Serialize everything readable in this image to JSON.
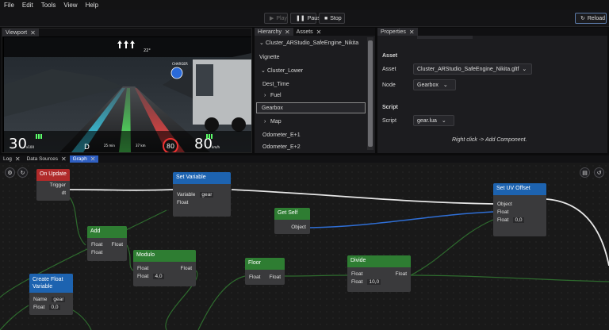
{
  "menu": [
    "File",
    "Edit",
    "Tools",
    "View",
    "Help"
  ],
  "toolbar": {
    "play": "Play",
    "pause": "Pause",
    "stop": "Stop",
    "reload": "Reload"
  },
  "viewport": {
    "tab": "Viewport",
    "hud": {
      "speed_left": "30",
      "speed_left_unit": "x100",
      "gear": "D",
      "distance_1": "25 min",
      "distance_2": "37 km",
      "speed_limit": "80",
      "speed_right": "80",
      "speed_right_unit": "km/h",
      "temp": "22°",
      "charger": "CHARGER"
    }
  },
  "hierarchy": {
    "tabs": [
      "Hierarchy",
      "Assets"
    ],
    "items": [
      {
        "label": "Cluster_ARStudio_SafeEngine_Nikita",
        "arrow": "⌄",
        "indent": 0
      },
      {
        "label": "Vignette",
        "arrow": "",
        "indent": 0
      },
      {
        "label": "Cluster_Lower",
        "arrow": "⌄",
        "indent": 1
      },
      {
        "label": "Dest_Time",
        "arrow": "",
        "indent": 1
      },
      {
        "label": "Fuel",
        "arrow": "›",
        "indent": 2
      },
      {
        "label": "Gearbox",
        "arrow": "",
        "indent": 1,
        "selected": true
      },
      {
        "label": "Map",
        "arrow": "›",
        "indent": 2
      },
      {
        "label": "Odometer_E+1",
        "arrow": "",
        "indent": 1
      },
      {
        "label": "Odometer_E+2",
        "arrow": "",
        "indent": 1
      }
    ]
  },
  "properties": {
    "tab": "Properties",
    "asset_header": "Asset",
    "asset_label": "Asset",
    "asset_value": "Cluster_ARStudio_SafeEngine_Nikita.gltf",
    "node_label": "Node",
    "node_value": "Gearbox",
    "script_header": "Script",
    "script_label": "Script",
    "script_value": "gear.lua",
    "hint": "Right click -> Add Component."
  },
  "bottom_tabs": [
    "Log",
    "Data Sources",
    "Graph"
  ],
  "graph": {
    "nodes": {
      "on_update": {
        "title": "On Update",
        "trigger": "Trigger",
        "dt": "dt"
      },
      "set_variable": {
        "title": "Set Variable",
        "variable": "Variable",
        "var_value": "gear",
        "float": "Float"
      },
      "get_self": {
        "title": "Get Self",
        "object": "Object"
      },
      "set_uv": {
        "title": "Set UV Offset",
        "object": "Object",
        "float1": "Float",
        "float2": "Float",
        "float2_value": "0,0"
      },
      "add": {
        "title": "Add",
        "in": "Float",
        "out": "Float",
        "in2": "Float"
      },
      "modulo": {
        "title": "Modulo",
        "in": "Float",
        "out": "Float",
        "in2": "Float",
        "in2_value": "4,0"
      },
      "floor": {
        "title": "Floor",
        "in": "Float",
        "out": "Float"
      },
      "divide": {
        "title": "Divide",
        "in": "Float",
        "out": "Float",
        "in2": "Float",
        "in2_value": "10,0"
      },
      "create_float": {
        "title": "Create Float Variable",
        "name": "Name",
        "name_value": "gear",
        "float": "Float",
        "float_value": "0,0"
      }
    }
  },
  "colors": {
    "accent": "#2f5fc2",
    "red_node": "#b02a2a",
    "blue_node": "#1d63b0",
    "green_node": "#2e7d32",
    "exec_wire": "#e6e6e6",
    "object_wire": "#2f6fd6",
    "float_wire": "#2e6b2e"
  }
}
